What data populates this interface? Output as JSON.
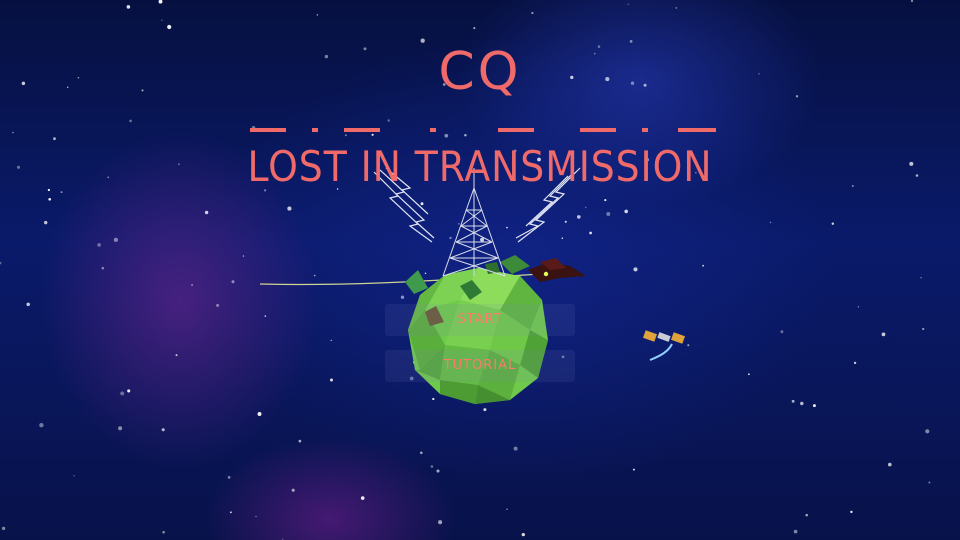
{
  "title": {
    "main": "CQ",
    "subtitle": "LOST IN TRANSMISSION"
  },
  "menu": {
    "start_label": "START",
    "tutorial_label": "TUTORIAL"
  },
  "icons": {
    "tower": "radio-tower-icon",
    "signal_left": "lightning-signal-icon",
    "signal_right": "lightning-signal-icon",
    "satellite": "satellite-icon",
    "planet": "planet-icon",
    "bird": "bird-icon"
  },
  "colors": {
    "title": "#f06a6a",
    "menu_text": "#ff7a6a",
    "planet": "#7ed35a",
    "background": "#0a1a6a"
  }
}
